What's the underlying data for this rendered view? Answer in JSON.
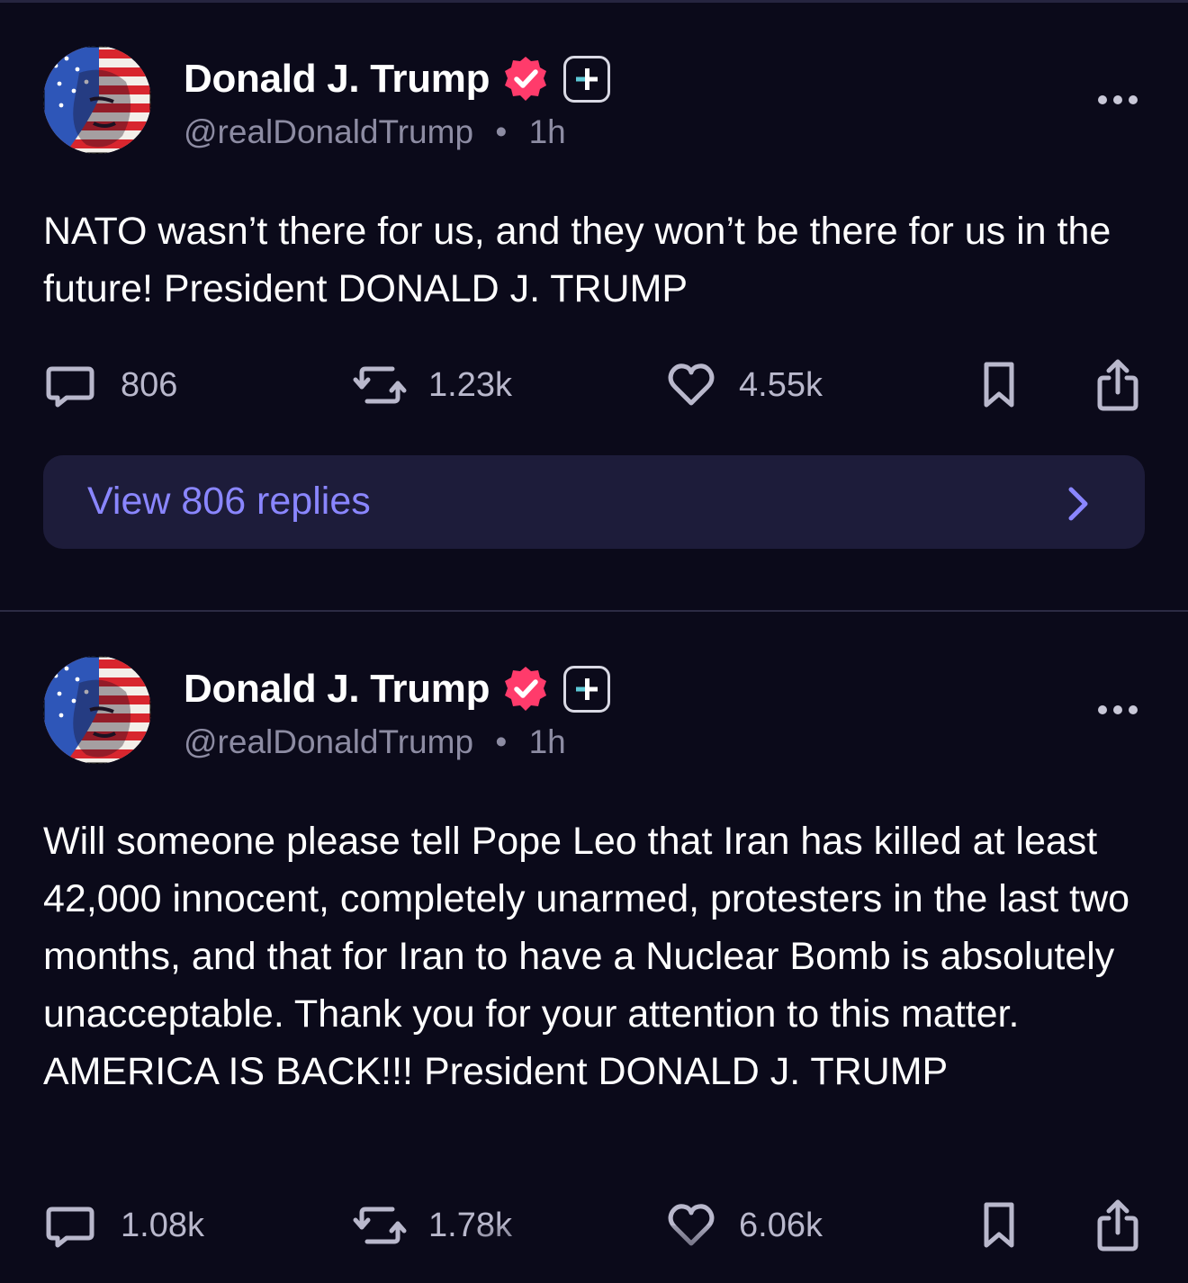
{
  "colors": {
    "background": "#0b0a1a",
    "accent": "#8a86ff",
    "verified": "#ff3b6b",
    "muted_text": "#8d8ca3",
    "replies_bg": "#1d1c3a"
  },
  "posts": [
    {
      "author": {
        "display_name": "Donald J. Trump",
        "handle": "@realDonaldTrump",
        "separator": "•",
        "time": "1h",
        "avatar_icon": "flag-portrait-avatar",
        "verified_icon": "verified-badge-icon",
        "plus_icon": "plus-badge-icon"
      },
      "text": "NATO wasn’t there for us, and they won’t be there for us in the future! President DONALD J. TRUMP",
      "stats": {
        "replies": "806",
        "reposts": "1.23k",
        "likes": "4.55k"
      },
      "view_replies_label": "View 806 replies"
    },
    {
      "author": {
        "display_name": "Donald J. Trump",
        "handle": "@realDonaldTrump",
        "separator": "•",
        "time": "1h",
        "avatar_icon": "flag-portrait-avatar",
        "verified_icon": "verified-badge-icon",
        "plus_icon": "plus-badge-icon"
      },
      "text": "Will someone please tell Pope Leo that Iran has killed at least 42,000 innocent, completely unarmed, protesters in the last two months, and that for Iran to have a Nuclear Bomb is absolutely unacceptable. Thank you for your attention to this matter. AMERICA IS BACK!!! President DONALD J. TRUMP",
      "stats": {
        "replies": "1.08k",
        "reposts": "1.78k",
        "likes": "6.06k"
      }
    }
  ]
}
